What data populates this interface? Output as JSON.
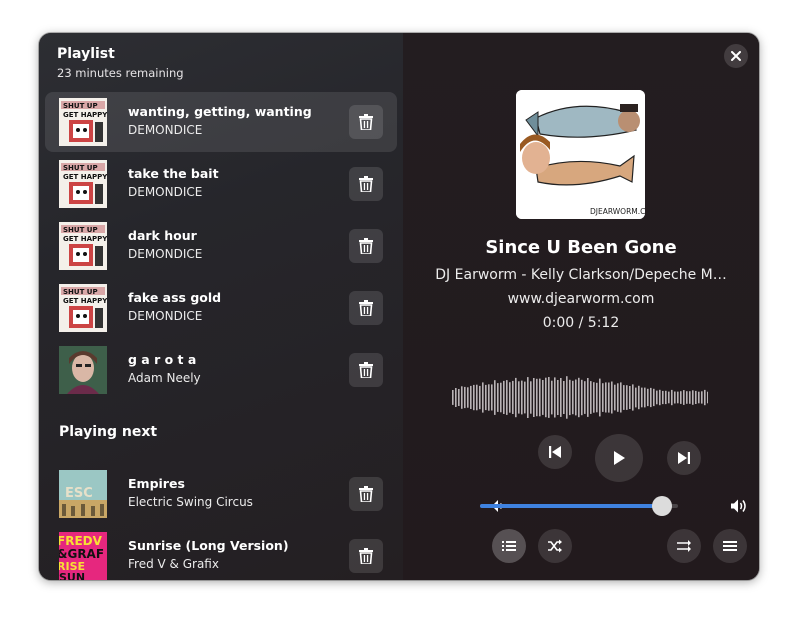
{
  "sidebar": {
    "title": "Playlist",
    "subtitle": "23 minutes remaining",
    "queue": [
      {
        "title": "wanting, getting, wanting",
        "artist": "DEMONDICE",
        "art": "album-art-shut-up",
        "active": true
      },
      {
        "title": "take the bait",
        "artist": "DEMONDICE",
        "art": "album-art-shut-up"
      },
      {
        "title": "dark hour",
        "artist": "DEMONDICE",
        "art": "album-art-shut-up"
      },
      {
        "title": "fake ass gold",
        "artist": "DEMONDICE",
        "art": "album-art-shut-up"
      },
      {
        "title": "g a r o t a",
        "artist": "Adam Neely",
        "art": "album-art-portrait"
      }
    ],
    "next_heading": "Playing next",
    "next": [
      {
        "title": "Empires",
        "artist": "Electric Swing Circus",
        "art": "album-art-esc"
      },
      {
        "title": "Sunrise (Long Version)",
        "artist": "Fred V & Grafix",
        "art": "album-art-fredv"
      }
    ]
  },
  "player": {
    "title": "Since U Been Gone",
    "artist": "DJ Earworm - Kelly Clarkson/Depeche M…",
    "album": "www.djearworm.com",
    "time": "0:00 / 5:12",
    "cover_text": "DJEARWORM.CO",
    "volume": 0.92
  },
  "icons": {
    "close": "close-icon",
    "trash": "trash-icon",
    "previous": "skip-previous-icon",
    "play": "play-icon",
    "next": "skip-next-icon",
    "volume_low": "volume-low-icon",
    "volume_high": "volume-high-icon",
    "queue": "queue-list-icon",
    "shuffle": "shuffle-icon",
    "repeat": "repeat-icon",
    "menu": "hamburger-menu-icon"
  },
  "colors": {
    "accent": "#3f82e0"
  }
}
